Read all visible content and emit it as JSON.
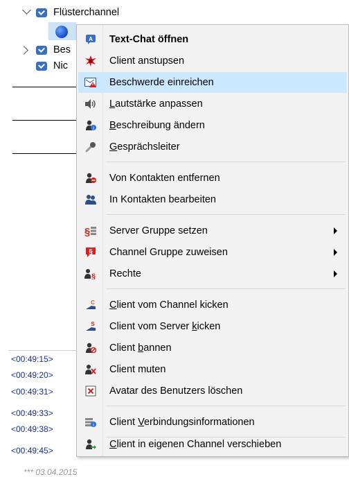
{
  "tree": {
    "channel_label": "Flüsterchannel",
    "row2_label": "Bes",
    "row3_label": "Nic"
  },
  "chat_log": {
    "timestamps": [
      "<00:49:15>",
      "<00:49:20>",
      "<00:49:31>",
      "<00:49:33>",
      "<00:49:38>",
      "<00:49:45>"
    ],
    "date_text": "*** 03.04.2015"
  },
  "menu": {
    "items": [
      {
        "label": "Text-Chat öffnen",
        "icon": "text-chat-icon"
      },
      {
        "label": "Client anstupsen",
        "icon": "poke-icon"
      },
      {
        "label": "Beschwerde einreichen",
        "icon": "complaint-icon"
      },
      {
        "label": "Lautstärke anpassen",
        "icon": "volume-icon"
      },
      {
        "label": "Beschreibung ändern",
        "icon": "edit-description-icon"
      },
      {
        "label": "Gesprächsleiter",
        "icon": "microphone-icon"
      },
      {
        "label": "Von Kontakten entfernen",
        "icon": "remove-contact-icon"
      },
      {
        "label": "In Kontakten bearbeiten",
        "icon": "edit-contact-icon"
      },
      {
        "label": "Server Gruppe setzen",
        "icon": "server-group-icon"
      },
      {
        "label": "Channel Gruppe zuweisen",
        "icon": "channel-group-icon"
      },
      {
        "label": "Rechte",
        "icon": "permissions-icon"
      },
      {
        "label": "Client vom Channel kicken",
        "icon": "kick-channel-icon"
      },
      {
        "label": "Client vom Server kicken",
        "icon": "kick-server-icon"
      },
      {
        "label": "Client bannen",
        "icon": "ban-icon"
      },
      {
        "label": "Client muten",
        "icon": "mute-icon"
      },
      {
        "label": "Avatar des Benutzers löschen",
        "icon": "delete-avatar-icon"
      },
      {
        "label": "Client Verbindungsinformationen",
        "icon": "connection-info-icon"
      },
      {
        "label": "Client in eigenen Channel verschieben",
        "icon": "move-client-icon"
      }
    ],
    "highlighted_index": 2
  },
  "colors": {
    "highlight": "#cce8ff",
    "menu_bg": "#f2f2f2",
    "log_text": "#1a2f9a"
  }
}
